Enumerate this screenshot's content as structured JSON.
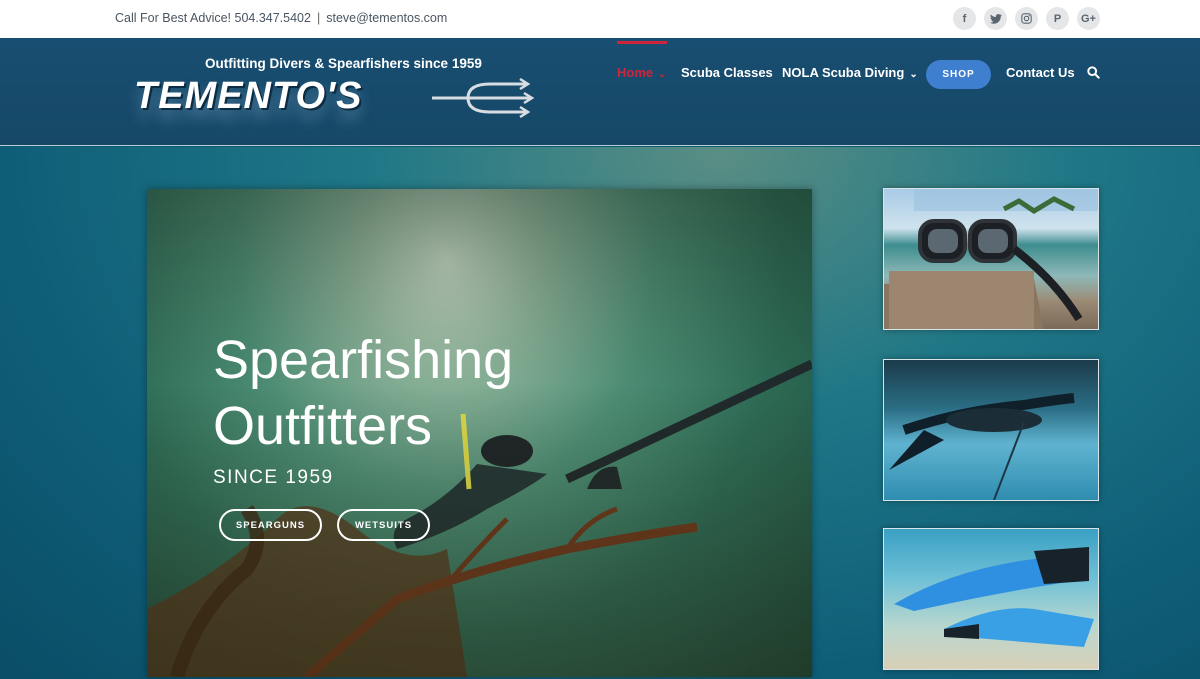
{
  "topbar": {
    "call_text": "Call For Best Advice! 504.347.5402",
    "separator": "|",
    "email": "steve@tementos.com",
    "socials": [
      {
        "name": "facebook-icon",
        "glyph": "f"
      },
      {
        "name": "twitter-icon",
        "glyph": "t"
      },
      {
        "name": "instagram-icon",
        "glyph": "◎"
      },
      {
        "name": "pinterest-icon",
        "glyph": "P"
      },
      {
        "name": "google-plus-icon",
        "glyph": "G+"
      }
    ]
  },
  "header": {
    "logo_tagline": "Outfitting Divers & Spearfishers since 1959",
    "logo_wordmark": "TEMENTO'S"
  },
  "nav": {
    "home": "Home",
    "scuba_classes": "Scuba Classes",
    "nola_scuba_diving": "NOLA Scuba Diving",
    "shop": "SHOP",
    "contact_us": "Contact Us"
  },
  "hero": {
    "title_line1": "Spearfishing",
    "title_line2": "Outfitters",
    "subtitle": "SINCE 1959",
    "button_spearguns": "SPEARGUNS",
    "button_wetsuits": "WETSUITS"
  },
  "colors": {
    "header_bg": "#184e72",
    "active_nav": "#d0243b",
    "shop_button": "#3f7fd0",
    "topbar_bg": "#ffffff"
  }
}
